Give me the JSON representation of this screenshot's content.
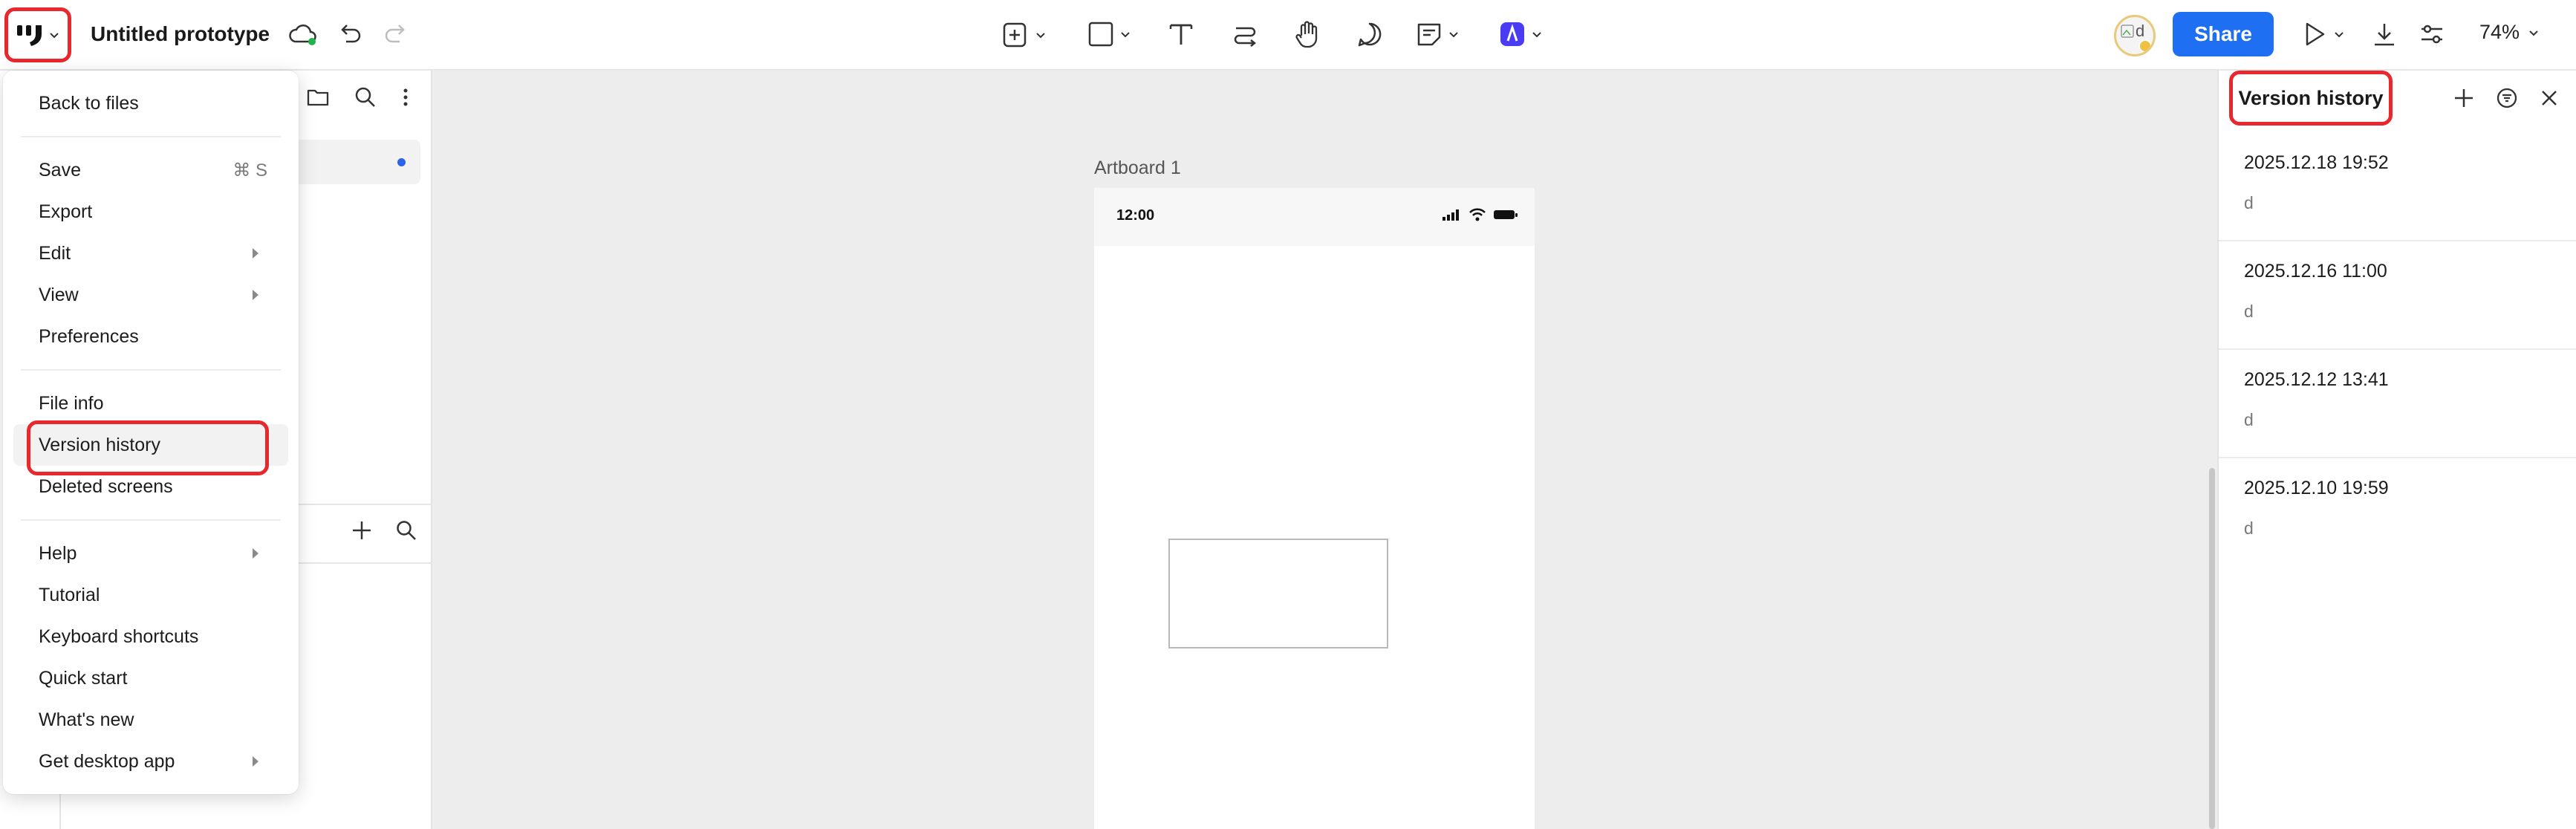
{
  "app": {
    "document_title": "Untitled prototype"
  },
  "toolbar": {
    "icons": [
      "insert-icon",
      "shape-icon",
      "text-icon",
      "connector-icon",
      "hand-icon",
      "comment-icon",
      "note-icon",
      "ai-icon"
    ],
    "share_label": "Share",
    "zoom_label": "74%",
    "avatar_letter": "d"
  },
  "main_menu": {
    "items": [
      {
        "label": "Back to files"
      },
      {
        "label": "Save",
        "shortcut": "⌘ S"
      },
      {
        "label": "Export"
      },
      {
        "label": "Edit",
        "submenu": true
      },
      {
        "label": "View",
        "submenu": true
      },
      {
        "label": "Preferences"
      },
      {
        "label": "File info"
      },
      {
        "label": "Version history",
        "highlighted": true
      },
      {
        "label": "Deleted screens"
      },
      {
        "label": "Help",
        "submenu": true
      },
      {
        "label": "Tutorial"
      },
      {
        "label": "Keyboard shortcuts"
      },
      {
        "label": "Quick start"
      },
      {
        "label": "What's new"
      },
      {
        "label": "Get desktop app",
        "submenu": true
      }
    ]
  },
  "canvas": {
    "artboard_label": "Artboard 1",
    "status_time": "12:00"
  },
  "version_history": {
    "title": "Version history",
    "versions": [
      {
        "date": "2025.12.18 19:52",
        "user": "d"
      },
      {
        "date": "2025.12.16 11:00",
        "user": "d"
      },
      {
        "date": "2025.12.12 13:41",
        "user": "d"
      },
      {
        "date": "2025.12.10 19:59",
        "user": "d"
      }
    ]
  },
  "colors": {
    "accent": "#1f6ff2",
    "highlight_outline": "#e8282d",
    "canvas_bg": "#ededed"
  }
}
